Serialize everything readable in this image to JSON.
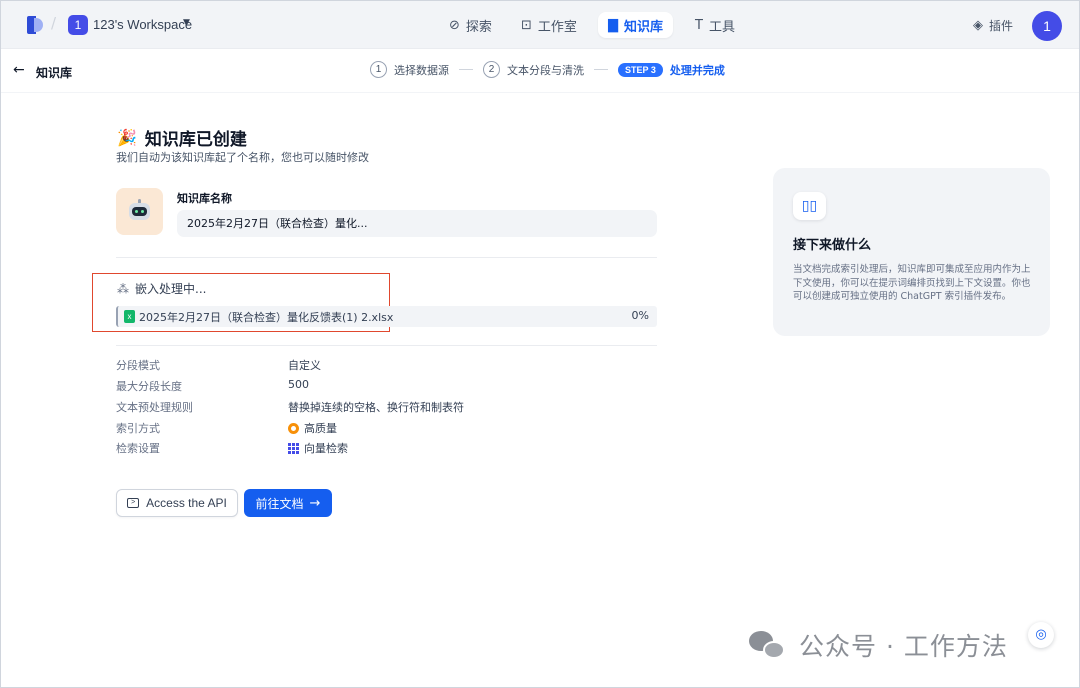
{
  "topbar": {
    "workspace_badge": "1",
    "workspace_name": "123's Workspace",
    "nav": [
      {
        "label": "探索",
        "icon": "compass-icon",
        "active": false
      },
      {
        "label": "工作室",
        "icon": "robot-icon",
        "active": false
      },
      {
        "label": "知识库",
        "icon": "book-icon",
        "active": true
      },
      {
        "label": "工具",
        "icon": "hammer-icon",
        "active": false
      }
    ],
    "plugin_label": "插件",
    "user_avatar": "1"
  },
  "subbar": {
    "title": "知识库",
    "steps": [
      {
        "num": "1",
        "label": "选择数据源"
      },
      {
        "num": "2",
        "label": "文本分段与清洗"
      },
      {
        "num": "STEP 3",
        "label": "处理并完成"
      }
    ]
  },
  "main": {
    "heading_emoji": "🎉",
    "heading": "知识库已创建",
    "subheading": "我们自动为该知识库起了个名称，您也可以随时修改",
    "kb_name_label": "知识库名称",
    "kb_name_value": "2025年2月27日（联合检查）量化...",
    "processing_title": "嵌入处理中...",
    "file": {
      "name": "2025年2月27日（联合检查）量化反馈表(1) 2.xlsx",
      "progress": "0%",
      "progress_value": 0
    },
    "meta": [
      {
        "key": "分段模式",
        "value": "自定义"
      },
      {
        "key": "最大分段长度",
        "value": "500"
      },
      {
        "key": "文本预处理规则",
        "value": "替换掉连续的空格、换行符和制表符"
      },
      {
        "key": "索引方式",
        "value": "高质量",
        "icon": "quality-badge-icon"
      },
      {
        "key": "检索设置",
        "value": "向量检索",
        "icon": "vector-grid-icon"
      }
    ],
    "api_button": "Access the API",
    "doc_button": "前往文档"
  },
  "next_card": {
    "title": "接下来做什么",
    "description": "当文档完成索引处理后，知识库即可集成至应用内作为上下文使用，你可以在提示词编排页找到上下文设置。你也可以创建成可独立使用的 ChatGPT 索引插件发布。"
  },
  "watermark": "公众号 · 工作方法",
  "colors": {
    "accent": "#155eef",
    "workspace_badge": "#444ce7",
    "highlight_box": "#e0482e"
  }
}
